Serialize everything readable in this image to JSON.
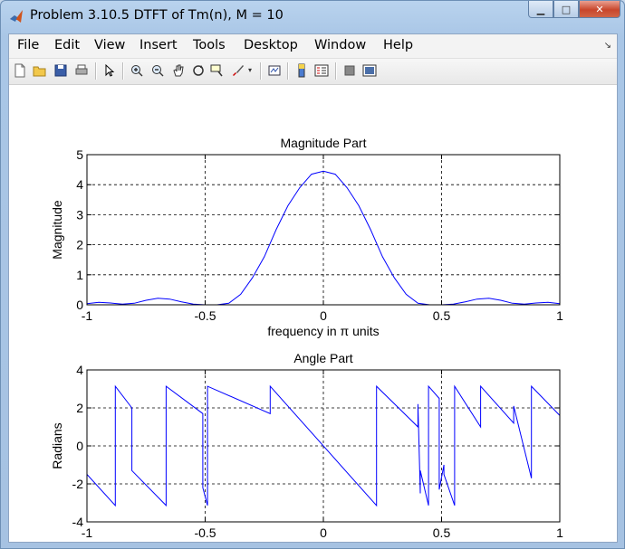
{
  "window": {
    "title": "Problem 3.10.5 DTFT of Tm(n), M = 10",
    "minimize_glyph": "▁",
    "maximize_glyph": "□",
    "close_glyph": "✕"
  },
  "menu": {
    "items": [
      "File",
      "Edit",
      "View",
      "Insert",
      "Tools",
      "Desktop",
      "Window",
      "Help"
    ],
    "overflow_glyph": "↘"
  },
  "toolbar": {
    "buttons": [
      "new-figure-icon",
      "open-file-icon",
      "save-icon",
      "print-icon",
      "pointer-icon",
      "zoom-in-icon",
      "zoom-out-icon",
      "pan-icon",
      "rotate-3d-icon",
      "data-cursor-icon",
      "brush-icon",
      "link-plot-icon",
      "colorbar-icon",
      "legend-icon",
      "hide-plot-tools-icon",
      "show-plot-tools-icon"
    ]
  },
  "chart_data": [
    {
      "type": "line",
      "title": "Magnitude Part",
      "xlabel": "frequency in π units",
      "ylabel": "Magnitude",
      "xlim": [
        -1,
        1
      ],
      "ylim": [
        0,
        5
      ],
      "xticks": [
        "-1",
        "-0.5",
        "0",
        "0.5",
        "1"
      ],
      "yticks": [
        "0",
        "1",
        "2",
        "3",
        "4",
        "5"
      ],
      "grid": true,
      "color": "#0000ff",
      "x": [
        -1.0,
        -0.95,
        -0.9,
        -0.85,
        -0.8,
        -0.75,
        -0.7,
        -0.65,
        -0.6,
        -0.55,
        -0.5,
        -0.45,
        -0.4,
        -0.35,
        -0.3,
        -0.25,
        -0.2,
        -0.15,
        -0.1,
        -0.05,
        0.0,
        0.05,
        0.1,
        0.15,
        0.2,
        0.25,
        0.3,
        0.35,
        0.4,
        0.45,
        0.5,
        0.55,
        0.6,
        0.65,
        0.7,
        0.75,
        0.8,
        0.85,
        0.9,
        0.95,
        1.0
      ],
      "y": [
        0.04,
        0.08,
        0.06,
        0.02,
        0.05,
        0.15,
        0.22,
        0.19,
        0.1,
        0.02,
        0.0,
        0.0,
        0.05,
        0.35,
        0.9,
        1.6,
        2.5,
        3.3,
        3.9,
        4.35,
        4.45,
        4.35,
        3.9,
        3.3,
        2.5,
        1.6,
        0.9,
        0.35,
        0.05,
        0.0,
        0.0,
        0.02,
        0.1,
        0.19,
        0.22,
        0.15,
        0.05,
        0.02,
        0.06,
        0.08,
        0.04
      ]
    },
    {
      "type": "line",
      "title": "Angle Part",
      "xlabel": "frequency in π units",
      "ylabel": "Radians",
      "xlim": [
        -1,
        1
      ],
      "ylim": [
        -4,
        4
      ],
      "xticks": [
        "-1",
        "-0.5",
        "0",
        "0.5",
        "1"
      ],
      "yticks": [
        "-4",
        "-2",
        "0",
        "2",
        "4"
      ],
      "grid": true,
      "color": "#0000ff",
      "x": [
        -1.0,
        -0.88,
        -0.88,
        -0.81,
        -0.81,
        -0.665,
        -0.665,
        -0.51,
        -0.51,
        -0.49,
        -0.49,
        -0.225,
        -0.225,
        0.225,
        0.225,
        0.4,
        0.4,
        0.41,
        0.41,
        0.445,
        0.445,
        0.49,
        0.49,
        0.51,
        0.51,
        0.555,
        0.555,
        0.665,
        0.665,
        0.805,
        0.805,
        0.88,
        0.88,
        1.0
      ],
      "y": [
        -1.5,
        -3.14,
        3.14,
        2.0,
        -1.3,
        -3.14,
        3.14,
        1.7,
        -2.2,
        -3.14,
        3.14,
        1.7,
        3.14,
        -3.14,
        3.14,
        1.0,
        2.2,
        -2.5,
        -1.3,
        -3.14,
        3.14,
        2.5,
        -2.3,
        -1.0,
        -1.5,
        -3.14,
        3.14,
        1.0,
        3.14,
        1.2,
        2.1,
        -1.7,
        3.14,
        1.6
      ]
    }
  ]
}
